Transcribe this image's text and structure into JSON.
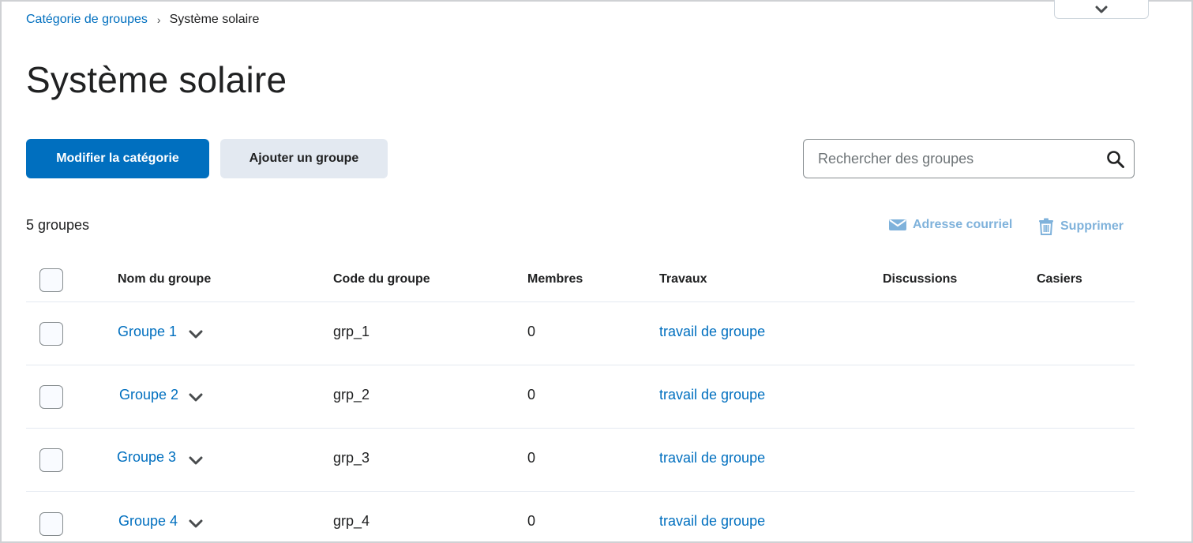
{
  "breadcrumb": {
    "parent": "Catégorie de groupes",
    "separator": "›",
    "current": "Système solaire"
  },
  "page": {
    "title": "Système solaire"
  },
  "toolbar": {
    "edit_category_label": "Modifier la catégorie",
    "add_group_label": "Ajouter un groupe"
  },
  "search": {
    "placeholder": "Rechercher des groupes",
    "value": ""
  },
  "summary": {
    "count_text": "5 groupes"
  },
  "actions": {
    "email_label": "Adresse courriel",
    "delete_label": "Supprimer"
  },
  "table": {
    "headers": {
      "name": "Nom du groupe",
      "code": "Code du groupe",
      "members": "Membres",
      "assignments": "Travaux",
      "discussions": "Discussions",
      "lockers": "Casiers"
    },
    "rows": [
      {
        "name": "Groupe 1",
        "code": "grp_1",
        "members": "0",
        "assignment": "travail de groupe"
      },
      {
        "name": "Groupe 2",
        "code": "grp_2",
        "members": "0",
        "assignment": "travail de groupe"
      },
      {
        "name": "Groupe 3",
        "code": "grp_3",
        "members": "0",
        "assignment": "travail de groupe"
      },
      {
        "name": "Groupe 4",
        "code": "grp_4",
        "members": "0",
        "assignment": "travail de groupe"
      }
    ]
  },
  "colors": {
    "primary": "#006fbf",
    "link": "#006fbf",
    "disabled_action": "#7fb2db",
    "secondary_button_bg": "#e3e9f1",
    "text": "#202122"
  },
  "icons": {
    "top_dropdown": "chevron-down-icon",
    "search": "search-icon",
    "email": "envelope-icon",
    "delete": "trash-icon",
    "row_menu": "chevron-down-icon"
  }
}
